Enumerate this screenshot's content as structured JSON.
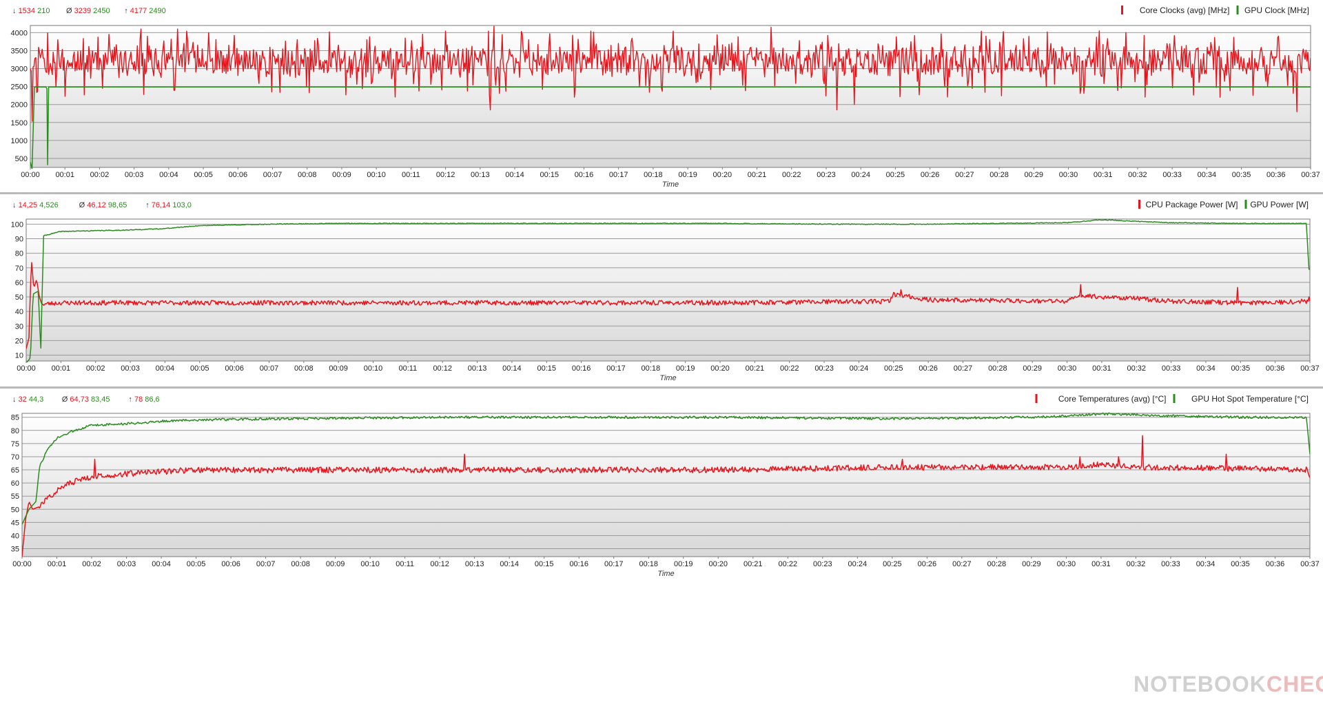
{
  "watermark": {
    "text_a": "NOTEBOOK",
    "text_b": "CHECK"
  },
  "chart_data": [
    {
      "id": "clocks",
      "type": "line",
      "stats": {
        "min": {
          "symbol": "↓",
          "values": [
            "1534",
            "210"
          ]
        },
        "avg": {
          "symbol": "Ø",
          "values": [
            "3239",
            "2450"
          ]
        },
        "max": {
          "symbol": "↑",
          "values": [
            "4177",
            "2490"
          ]
        }
      },
      "legend": [
        "Core Clocks (avg) [MHz]",
        "GPU Clock [MHz]"
      ],
      "yticks": [
        "500",
        "1000",
        "1500",
        "2000",
        "2500",
        "3000",
        "3500",
        "4000"
      ],
      "ylim": [
        250,
        4200
      ],
      "xlabel": "Time",
      "xticks": [
        "00:00",
        "00:01",
        "00:02",
        "00:03",
        "00:04",
        "00:05",
        "00:06",
        "00:07",
        "00:08",
        "00:09",
        "00:10",
        "00:11",
        "00:12",
        "00:13",
        "00:14",
        "00:15",
        "00:16",
        "00:17",
        "00:18",
        "00:19",
        "00:20",
        "00:21",
        "00:22",
        "00:23",
        "00:24",
        "00:25",
        "00:26",
        "00:27",
        "00:28",
        "00:29",
        "00:30",
        "00:31",
        "00:32",
        "00:33",
        "00:34",
        "00:35",
        "00:36",
        "00:37"
      ],
      "xlim_minutes": [
        0,
        37
      ],
      "series": [
        {
          "name": "Core Clocks (avg) [MHz]",
          "color": "#e8131b",
          "kind": "noise",
          "base": 3200,
          "amp": 380,
          "spike_up": 4050,
          "spike_down": 2200,
          "seed": 11,
          "extremes": [
            [
              0.05,
              1534
            ],
            [
              3.2,
              4100
            ],
            [
              4.25,
              4100
            ],
            [
              13.3,
              1850
            ],
            [
              13.4,
              4177
            ],
            [
              21.4,
              4150
            ],
            [
              23.3,
              1850
            ],
            [
              23.8,
              2000
            ],
            [
              30.9,
              4050
            ],
            [
              36.6,
              1800
            ]
          ],
          "start": 3000,
          "end": 3300
        },
        {
          "name": "GPU Clock [MHz]",
          "color": "#2a8c1e",
          "kind": "steps",
          "points": [
            [
              0,
              400
            ],
            [
              0.05,
              210
            ],
            [
              0.12,
              2490
            ],
            [
              0.45,
              2490
            ],
            [
              0.48,
              2440
            ],
            [
              0.5,
              320
            ],
            [
              0.53,
              2490
            ],
            [
              37,
              2490
            ]
          ]
        }
      ]
    },
    {
      "id": "power",
      "type": "line",
      "stats": {
        "min": {
          "symbol": "↓",
          "values": [
            "14,25",
            "4,526"
          ]
        },
        "avg": {
          "symbol": "Ø",
          "values": [
            "46,12",
            "98,65"
          ]
        },
        "max": {
          "symbol": "↑",
          "values": [
            "76,14",
            "103,0"
          ]
        }
      },
      "legend": [
        "CPU Package Power [W]",
        "GPU Power [W]"
      ],
      "yticks": [
        "10",
        "20",
        "30",
        "40",
        "50",
        "60",
        "70",
        "80",
        "90",
        "100"
      ],
      "ylim": [
        6,
        103.5
      ],
      "xlabel": "Time",
      "xticks": [
        "00:00",
        "00:01",
        "00:02",
        "00:03",
        "00:04",
        "00:05",
        "00:06",
        "00:07",
        "00:08",
        "00:09",
        "00:10",
        "00:11",
        "00:12",
        "00:13",
        "00:14",
        "00:15",
        "00:16",
        "00:17",
        "00:18",
        "00:19",
        "00:20",
        "00:21",
        "00:22",
        "00:23",
        "00:24",
        "00:25",
        "00:26",
        "00:27",
        "00:28",
        "00:29",
        "00:30",
        "00:31",
        "00:32",
        "00:33",
        "00:34",
        "00:35",
        "00:36",
        "00:37"
      ],
      "xlim_minutes": [
        0,
        37
      ],
      "series": [
        {
          "name": "CPU Package Power [W]",
          "color": "#e8131b",
          "kind": "curve",
          "noise": 1.6,
          "seed": 23,
          "points": [
            [
              0,
              14.3
            ],
            [
              0.08,
              22
            ],
            [
              0.15,
              76.1
            ],
            [
              0.22,
              56
            ],
            [
              0.3,
              62
            ],
            [
              0.38,
              50
            ],
            [
              0.45,
              45
            ],
            [
              1,
              46
            ],
            [
              5,
              46
            ],
            [
              10,
              46
            ],
            [
              15,
              46
            ],
            [
              20,
              46
            ],
            [
              24.9,
              47
            ],
            [
              25,
              52
            ],
            [
              26,
              48
            ],
            [
              30,
              47
            ],
            [
              30.4,
              51
            ],
            [
              31,
              50
            ],
            [
              32,
              49
            ],
            [
              33,
              47
            ],
            [
              35,
              46
            ],
            [
              37,
              47
            ]
          ],
          "spikes": [
            [
              25.2,
              55
            ],
            [
              30.4,
              58.5
            ],
            [
              34.9,
              56.5
            ],
            [
              36.98,
              50
            ]
          ]
        },
        {
          "name": "GPU Power [W]",
          "color": "#2a8c1e",
          "kind": "curve",
          "noise": 0.25,
          "seed": 41,
          "points": [
            [
              0,
              4.5
            ],
            [
              0.12,
              8
            ],
            [
              0.2,
              52
            ],
            [
              0.35,
              54
            ],
            [
              0.42,
              12
            ],
            [
              0.5,
              92
            ],
            [
              1,
              95
            ],
            [
              3,
              96
            ],
            [
              4,
              97
            ],
            [
              5,
              99
            ],
            [
              7,
              100
            ],
            [
              9,
              100.5
            ],
            [
              15,
              100.5
            ],
            [
              20,
              100.5
            ],
            [
              23,
              100
            ],
            [
              26,
              100
            ],
            [
              30,
              101
            ],
            [
              31,
              103
            ],
            [
              32,
              102
            ],
            [
              33,
              101
            ],
            [
              35,
              100.5
            ],
            [
              36.9,
              100.5
            ],
            [
              36.97,
              69
            ]
          ]
        }
      ]
    },
    {
      "id": "temps",
      "type": "line",
      "stats": {
        "min": {
          "symbol": "↓",
          "values": [
            "32",
            "44,3"
          ]
        },
        "avg": {
          "symbol": "Ø",
          "values": [
            "64,73",
            "83,45"
          ]
        },
        "max": {
          "symbol": "↑",
          "values": [
            "78",
            "86,6"
          ]
        }
      },
      "legend": [
        "Core Temperatures (avg) [°C]",
        "GPU Hot Spot Temperature [°C]"
      ],
      "yticks": [
        "35",
        "40",
        "45",
        "50",
        "55",
        "60",
        "65",
        "70",
        "75",
        "80",
        "85"
      ],
      "ylim": [
        32,
        86.5
      ],
      "xlabel": "Time",
      "xticks": [
        "00:00",
        "00:01",
        "00:02",
        "00:03",
        "00:04",
        "00:05",
        "00:06",
        "00:07",
        "00:08",
        "00:09",
        "00:10",
        "00:11",
        "00:12",
        "00:13",
        "00:14",
        "00:15",
        "00:16",
        "00:17",
        "00:18",
        "00:19",
        "00:20",
        "00:21",
        "00:22",
        "00:23",
        "00:24",
        "00:25",
        "00:26",
        "00:27",
        "00:28",
        "00:29",
        "00:30",
        "00:31",
        "00:32",
        "00:33",
        "00:34",
        "00:35",
        "00:36",
        "00:37"
      ],
      "xlim_minutes": [
        0,
        37
      ],
      "series": [
        {
          "name": "Core Temperatures (avg) [°C]",
          "color": "#e8131b",
          "kind": "curve",
          "noise": 1.1,
          "seed": 57,
          "points": [
            [
              0,
              32
            ],
            [
              0.1,
              46
            ],
            [
              0.2,
              53
            ],
            [
              0.3,
              50
            ],
            [
              0.5,
              51
            ],
            [
              0.8,
              55
            ],
            [
              1.2,
              59
            ],
            [
              1.8,
              62
            ],
            [
              2.5,
              63
            ],
            [
              3.5,
              64
            ],
            [
              5,
              65
            ],
            [
              10,
              65
            ],
            [
              20,
              65
            ],
            [
              25,
              66
            ],
            [
              30,
              66
            ],
            [
              31,
              67
            ],
            [
              32,
              66
            ],
            [
              35,
              65.5
            ],
            [
              36.9,
              65
            ],
            [
              37,
              62
            ]
          ],
          "spikes": [
            [
              2.1,
              69
            ],
            [
              12.7,
              71
            ],
            [
              25.3,
              69
            ],
            [
              30.4,
              70
            ],
            [
              31.5,
              70
            ],
            [
              32.2,
              78
            ],
            [
              34.6,
              71
            ]
          ]
        },
        {
          "name": "GPU Hot Spot Temperature [°C]",
          "color": "#2a8c1e",
          "kind": "curve",
          "noise": 0.45,
          "seed": 73,
          "points": [
            [
              0,
              44.3
            ],
            [
              0.2,
              50
            ],
            [
              0.4,
              53
            ],
            [
              0.5,
              66
            ],
            [
              0.7,
              72
            ],
            [
              1,
              77
            ],
            [
              1.5,
              80
            ],
            [
              2,
              82
            ],
            [
              3,
              82.5
            ],
            [
              4,
              83.5
            ],
            [
              5,
              84
            ],
            [
              8,
              84.5
            ],
            [
              12,
              85
            ],
            [
              20,
              85
            ],
            [
              25,
              84.5
            ],
            [
              29,
              85
            ],
            [
              30,
              85.5
            ],
            [
              31,
              86.3
            ],
            [
              32,
              86
            ],
            [
              33,
              85.5
            ],
            [
              35,
              85
            ],
            [
              36.9,
              85
            ],
            [
              37,
              71
            ]
          ]
        }
      ]
    }
  ]
}
